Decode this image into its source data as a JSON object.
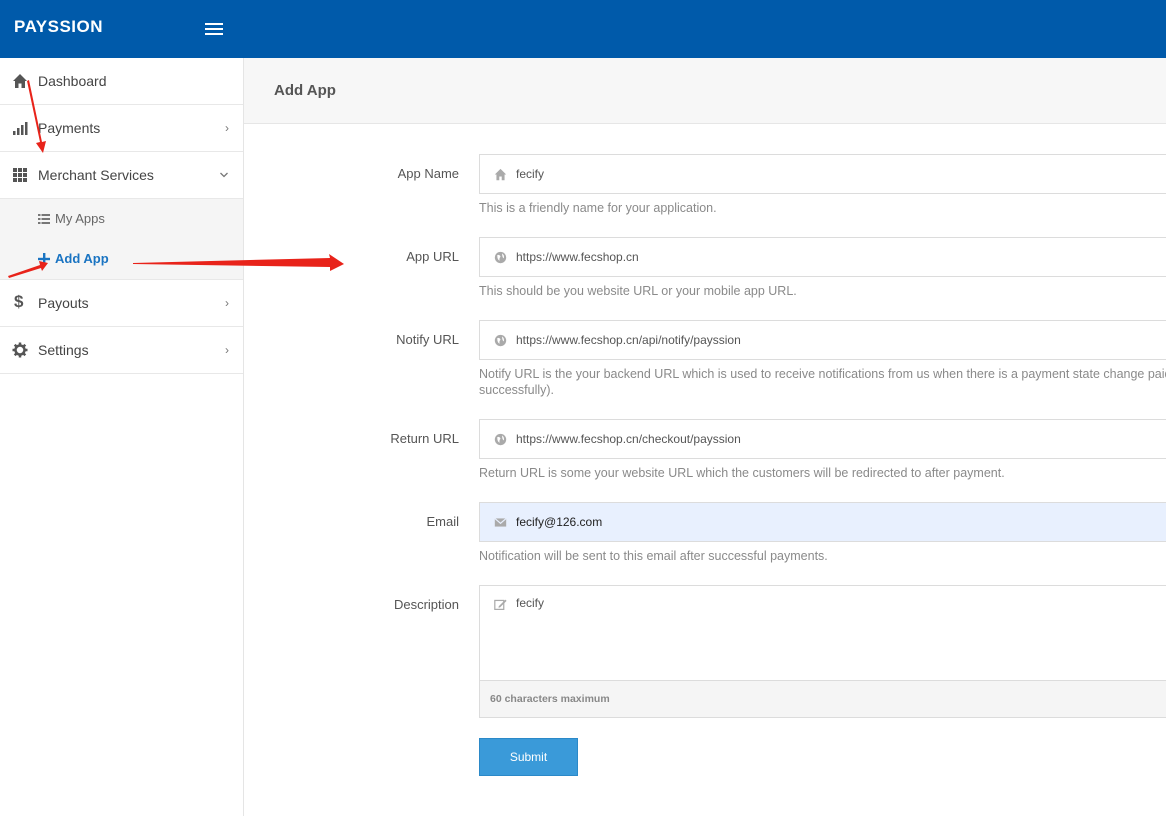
{
  "app": {
    "brand": "PAYSSION"
  },
  "sidebar": {
    "items": [
      {
        "label": "Dashboard"
      },
      {
        "label": "Payments"
      },
      {
        "label": "Merchant Services"
      },
      {
        "label": "Payouts"
      },
      {
        "label": "Settings"
      }
    ],
    "submenu": [
      {
        "label": "My Apps"
      },
      {
        "label": "Add App"
      }
    ]
  },
  "page": {
    "title": "Add App"
  },
  "form": {
    "app_name": {
      "label": "App Name",
      "value": "fecify",
      "help": "This is a friendly name for your application."
    },
    "app_url": {
      "label": "App URL",
      "value": "https://www.fecshop.cn",
      "help": "This should be you website URL or your mobile app URL."
    },
    "notify_url": {
      "label": "Notify URL",
      "value": "https://www.fecshop.cn/api/notify/payssion",
      "help": "Notify URL is the your backend URL which is used to receive notifications from us when there is a payment state change paid successfully)."
    },
    "return_url": {
      "label": "Return URL",
      "value": "https://www.fecshop.cn/checkout/payssion",
      "help": "Return URL is some your website URL which the customers will be redirected to after payment."
    },
    "email": {
      "label": "Email",
      "value": "fecify@126.com",
      "help": "Notification will be sent to this email after successful payments."
    },
    "description": {
      "label": "Description",
      "value": "fecify",
      "hint": "60 characters maximum"
    },
    "submit_label": "Submit"
  },
  "colors": {
    "topbar": "#005aaa",
    "accent": "#1a74c2",
    "button": "#3a9ad9",
    "annotation": "#e8231a"
  }
}
